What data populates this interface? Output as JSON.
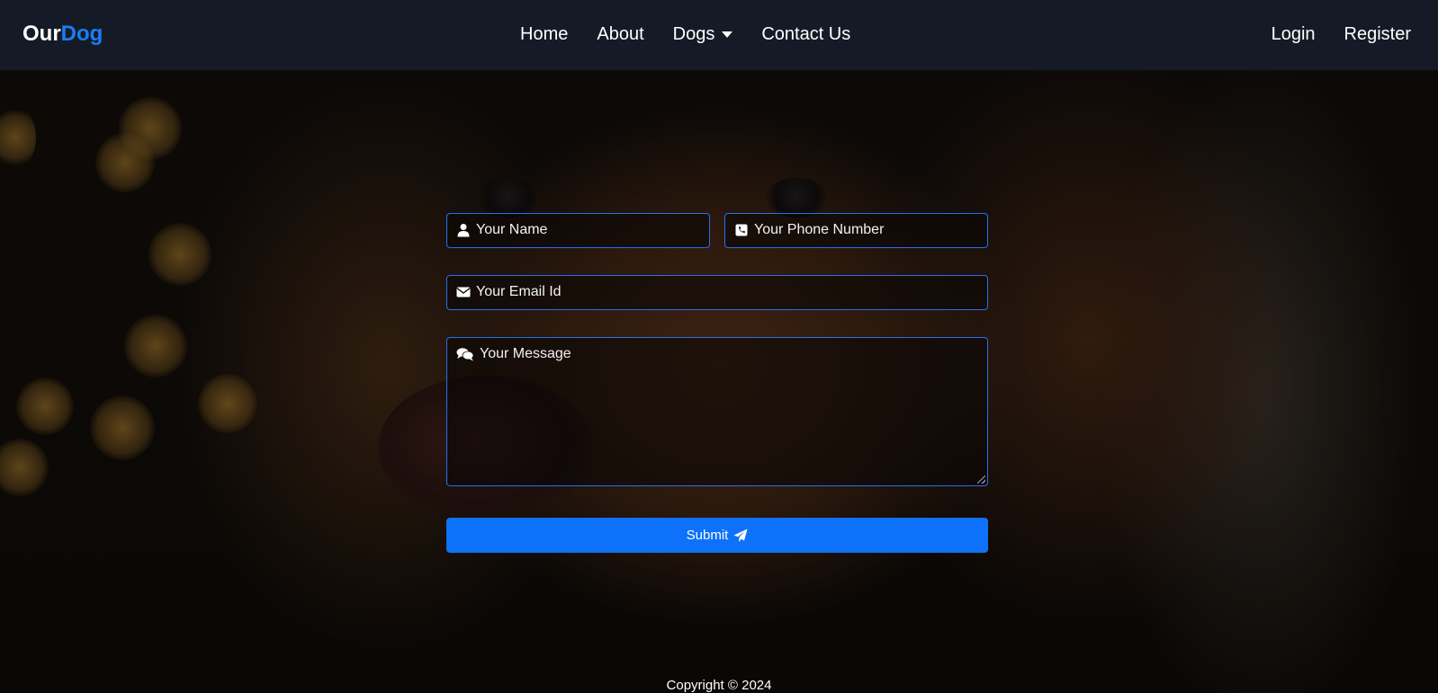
{
  "brand": {
    "part1": "Our",
    "part2": "Dog"
  },
  "nav": {
    "center": [
      {
        "label": "Home"
      },
      {
        "label": "About"
      },
      {
        "label": "Dogs"
      },
      {
        "label": "Contact Us"
      }
    ],
    "right": [
      {
        "label": "Login"
      },
      {
        "label": "Register"
      }
    ]
  },
  "form": {
    "name_placeholder": "Your Name",
    "phone_placeholder": "Your Phone Number",
    "email_placeholder": "Your Email Id",
    "message_placeholder": "Your Message",
    "submit_label": "Submit"
  },
  "footer": {
    "copyright": "Copyright © 2024"
  },
  "colors": {
    "navbar": "#141b26",
    "accent": "#0d72f9",
    "field_border": "#2a6ef0"
  },
  "icons": {
    "name": "user-icon",
    "phone": "phone-icon",
    "email": "envelope-icon",
    "message": "comments-icon",
    "submit": "paper-plane-icon",
    "dogs": "caret-down-icon"
  }
}
